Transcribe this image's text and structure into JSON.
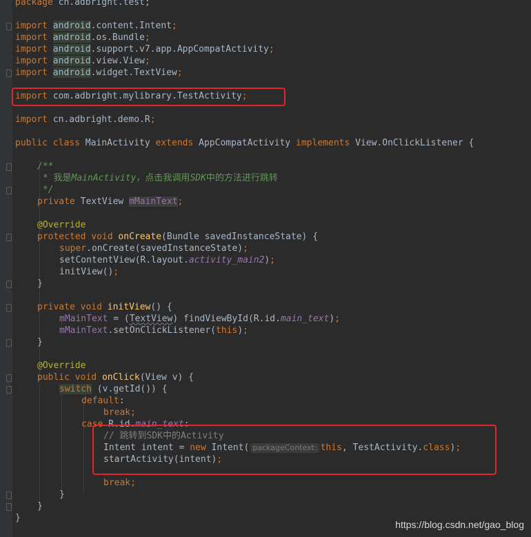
{
  "code": {
    "l0_kw": "package",
    "l0_rest": " cn.adbright.test;",
    "import_kw": "import",
    "i1_a": "android",
    "i1_b": ".content.Intent",
    "i2_a": "android",
    "i2_b": ".os.Bundle",
    "i3_a": "android",
    "i3_b": ".support.v7.app.AppCompatActivity",
    "i4_a": "android",
    "i4_b": ".view.View",
    "i5_a": "android",
    "i5_b": ".widget.TextView",
    "i6_rest": " com.adbright.mylibrary.TestActivity",
    "i7_rest": " cn.adbright.demo.R",
    "semi": ";",
    "cls_public": "public",
    "cls_class": "class",
    "cls_name": " MainActivity ",
    "cls_extends": "extends",
    "cls_super": " AppCompatActivity ",
    "cls_implements": "implements",
    "cls_iface": " View.OnClickListener {",
    "doc_open": "/**",
    "doc_star": " * ",
    "doc_t1": "我是",
    "doc_t2": "MainActivity",
    "doc_t3": "，点击我调用",
    "doc_t4": "SDK",
    "doc_t5": "中的方法进行跳转",
    "doc_close": " */",
    "f_private": "private",
    "f_type": " TextView ",
    "f_name": "mMainText",
    "override": "@Override",
    "m1_protected": "protected",
    "m1_void": "void",
    "m1_name": "onCreate",
    "m1_params": "(Bundle savedInstanceState) {",
    "s1_super": "super",
    "s1_call": ".onCreate(savedInstanceState)",
    "s2_a": "setContentView(R.layout.",
    "s2_b": "activity_main2",
    "s2_c": ")",
    "s3": "initView()",
    "brace_close": "}",
    "m2_private": "private",
    "m2_void": "void",
    "m2_name": "initView",
    "m2_params": "() {",
    "s4_field": "mMainText",
    "s4_a": " = (",
    "s4_cast": "TextView",
    "s4_b": ") findViewById(R.id.",
    "s4_id": "main_text",
    "s4_c": ")",
    "s5_field": "mMainText",
    "s5_a": ".setOnClickListener(",
    "s5_this": "this",
    "s5_b": ")",
    "m3_public": "public",
    "m3_void": "void",
    "m3_name": "onClick",
    "m3_params": "(View v) {",
    "sw_kw": "switch",
    "sw_rest": " (v.getId()) {",
    "def_kw": "default",
    "colon": ":",
    "break_kw": "break",
    "case_kw": "case",
    "case_a": " R.id.",
    "case_id": "main_text",
    "cmt": "// 跳转到SDK中的Activity",
    "in_type": "Intent intent = ",
    "in_new": "new",
    "in_b": " Intent(",
    "in_hint": "packageContext:",
    "in_this": "this",
    "in_c": ", TestActivity.",
    "in_class": "class",
    "in_d": ")",
    "start": "startActivity(intent)"
  },
  "watermark": "https://blog.csdn.net/gao_blog"
}
